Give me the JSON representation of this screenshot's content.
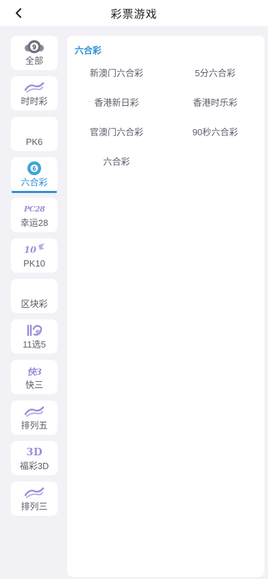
{
  "header": {
    "title": "彩票游戏"
  },
  "sidebar": {
    "items": [
      {
        "label": "全部",
        "icon": "lottery-ball-9-icon",
        "icon_text": "9"
      },
      {
        "label": "时时彩",
        "icon": "shishicai-logo-icon"
      },
      {
        "label": "PK6",
        "icon": ""
      },
      {
        "label": "六合彩",
        "icon": "liuhecai-ball-icon",
        "icon_text": "6",
        "active": true
      },
      {
        "label": "幸运28",
        "icon": "pc28-logo-icon",
        "icon_text": "PC28"
      },
      {
        "label": "PK10",
        "icon": "pk10-logo-icon",
        "icon_text": "10"
      },
      {
        "label": "区块彩",
        "icon": ""
      },
      {
        "label": "11选5",
        "icon": "11x5-logo-icon"
      },
      {
        "label": "快三",
        "icon": "kuai3-logo-icon",
        "icon_text": "快3"
      },
      {
        "label": "排列五",
        "icon": "pailie-logo-icon"
      },
      {
        "label": "福彩3D",
        "icon": "3d-logo-icon",
        "icon_text": "3D"
      },
      {
        "label": "排列三",
        "icon": "pailie-logo-icon"
      }
    ]
  },
  "main": {
    "section_title": "六合彩",
    "games": [
      "新澳门六合彩",
      "5分六合彩",
      "香港新日彩",
      "香港时乐彩",
      "官澳门六合彩",
      "90秒六合彩",
      "六合彩"
    ]
  },
  "colors": {
    "accent": "#2e8fd6",
    "background": "#f1f1f6",
    "card": "#ffffff",
    "text_muted": "#5c5c6b",
    "icon_purple": "#9b8fd8"
  }
}
